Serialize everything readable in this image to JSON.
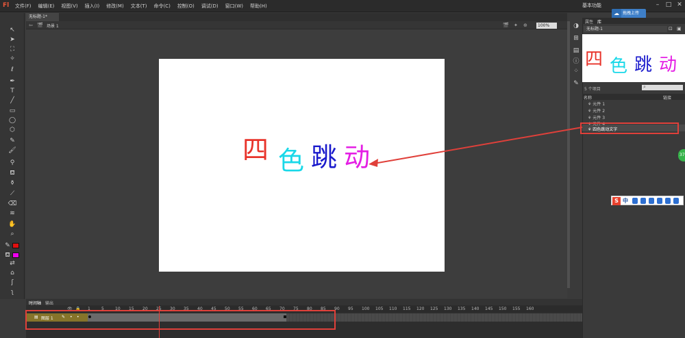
{
  "app": {
    "logo": "Fl"
  },
  "menu": {
    "items": [
      "文件(F)",
      "编辑(E)",
      "视图(V)",
      "插入(I)",
      "修改(M)",
      "文本(T)",
      "命令(C)",
      "控制(O)",
      "调试(D)",
      "窗口(W)",
      "帮助(H)"
    ]
  },
  "workspace": {
    "label": "基本功能"
  },
  "cloud": {
    "label": "拖拽上传"
  },
  "document": {
    "tab_title": "无标题-1*",
    "scene_label": "场景 1",
    "zoom": "100%"
  },
  "stage": {
    "chars": [
      {
        "text": "四",
        "color": "#e8332a"
      },
      {
        "text": "色",
        "color": "#19d8e8"
      },
      {
        "text": "跳",
        "color": "#1a1acc"
      },
      {
        "text": "动",
        "color": "#e41ee4"
      }
    ]
  },
  "panel": {
    "tabs": [
      "属性",
      "库"
    ],
    "library_select": "无标题-1",
    "item_count": "5 个项目",
    "columns": {
      "name": "名称",
      "linkage": "链接"
    },
    "items": [
      "元件 1",
      "元件 2",
      "元件 3",
      "元件 4",
      "四色跳动文字"
    ]
  },
  "colors": {
    "stroke": "#e11010",
    "fill": "#ee00ee",
    "accent_red": "#e0403a"
  },
  "timeline": {
    "tabs": [
      "时间轴",
      "输出"
    ],
    "layer_name": "图层 1",
    "ticks": [
      "1",
      "5",
      "10",
      "15",
      "20",
      "25",
      "30",
      "35",
      "40",
      "45",
      "50",
      "55",
      "60",
      "65",
      "70",
      "75",
      "80",
      "85",
      "90",
      "95",
      "100",
      "105",
      "110",
      "115",
      "120",
      "125",
      "130",
      "135",
      "140",
      "145",
      "150",
      "155",
      "160"
    ]
  },
  "ime": {
    "label": "中"
  },
  "badge": {
    "text": "37"
  }
}
